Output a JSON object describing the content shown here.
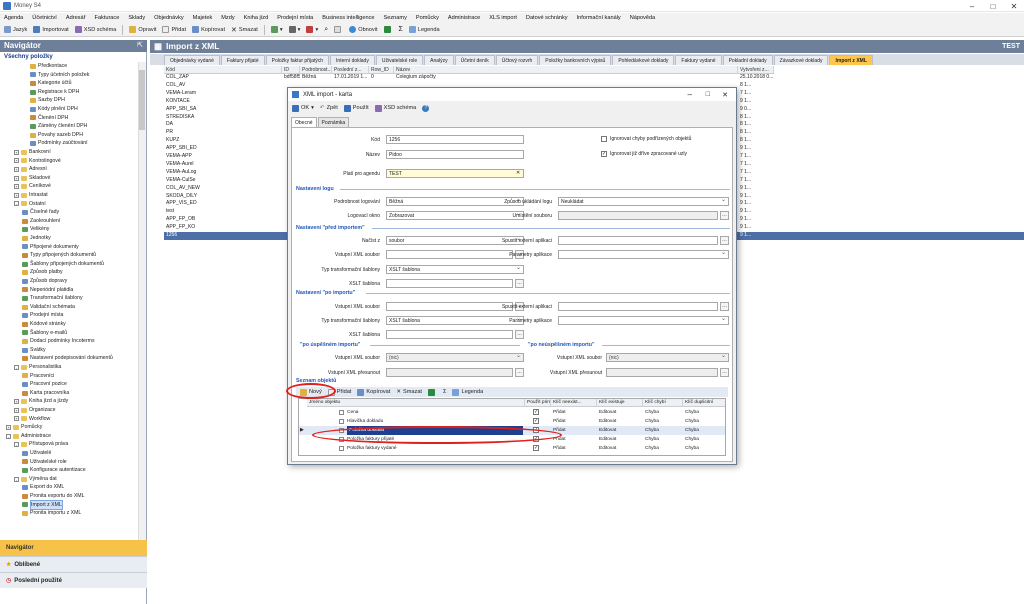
{
  "app": {
    "title": "Money S4"
  },
  "menu": [
    "Agenda",
    "Účetnictví",
    "Adresář",
    "Fakturace",
    "Sklady",
    "Objednávky",
    "Majetek",
    "Mzdy",
    "Kniha jízd",
    "Prodejní místa",
    "Business intelligence",
    "Seznamy",
    "Pomůcky",
    "Administrace",
    "XLS import",
    "Datové schránky",
    "Informační kanály",
    "Nápověda"
  ],
  "toolbar": {
    "jazyk": "Jazyk",
    "importovat": "Importovat",
    "xsd": "XSD schéma",
    "opravit": "Opravit",
    "pridat": "Přidat",
    "kopirovat": "Kopírovat",
    "smazat": "Smazat",
    "obnovit": "Obnovit",
    "legenda": "Legenda"
  },
  "navigator": {
    "title": "Navigátor",
    "subtitle": "Všechny položky",
    "items": [
      {
        "label": "Předkontace",
        "indent": 3
      },
      {
        "label": "Typy účetních položek",
        "indent": 3
      },
      {
        "label": "Kategorie účtů",
        "indent": 3
      },
      {
        "label": "Registrace k DPH",
        "indent": 3
      },
      {
        "label": "Sazby DPH",
        "indent": 3
      },
      {
        "label": "Kódy plnění DPH",
        "indent": 3
      },
      {
        "label": "Členění DPH",
        "indent": 3
      },
      {
        "label": "Záměny členění DPH",
        "indent": 3
      },
      {
        "label": "Povahy sazeb DPH",
        "indent": 3
      },
      {
        "label": "Podmínky zaúčtování",
        "indent": 3
      },
      {
        "label": "Bankovní",
        "indent": 1,
        "exp": "+"
      },
      {
        "label": "Kontrolingové",
        "indent": 1,
        "exp": "+"
      },
      {
        "label": "Adresní",
        "indent": 1,
        "exp": "+"
      },
      {
        "label": "Skladové",
        "indent": 1,
        "exp": "+"
      },
      {
        "label": "Ceníkové",
        "indent": 1,
        "exp": "+"
      },
      {
        "label": "Intrastat",
        "indent": 1,
        "exp": "+"
      },
      {
        "label": "Ostatní",
        "indent": 1,
        "exp": "-"
      },
      {
        "label": "Číselné řady",
        "indent": 2
      },
      {
        "label": "Zaokrouhlení",
        "indent": 2
      },
      {
        "label": "Velikény",
        "indent": 2
      },
      {
        "label": "Jednotky",
        "indent": 2
      },
      {
        "label": "Připojené dokumenty",
        "indent": 2
      },
      {
        "label": "Typy připojených dokumentů",
        "indent": 2
      },
      {
        "label": "Šablony připojených dokumentů",
        "indent": 2
      },
      {
        "label": "Způsob platby",
        "indent": 2
      },
      {
        "label": "Způsob dopravy",
        "indent": 2
      },
      {
        "label": "Neperiódní platidla",
        "indent": 2
      },
      {
        "label": "Transformační šablony",
        "indent": 2
      },
      {
        "label": "Validační schémata",
        "indent": 2
      },
      {
        "label": "Prodejní místa",
        "indent": 2
      },
      {
        "label": "Kódové stránky",
        "indent": 2
      },
      {
        "label": "Šablony e-mailů",
        "indent": 2
      },
      {
        "label": "Dodací podmínky Incoterms",
        "indent": 2
      },
      {
        "label": "Svátky",
        "indent": 2
      },
      {
        "label": "Nastavení podepisování dokumentů",
        "indent": 2
      },
      {
        "label": "Personalistika",
        "indent": 1,
        "exp": "-"
      },
      {
        "label": "Pracovníci",
        "indent": 2
      },
      {
        "label": "Pracovní pozice",
        "indent": 2
      },
      {
        "label": "Karta pracovníka",
        "indent": 2
      },
      {
        "label": "Kniha jízd a jízdy",
        "indent": 1,
        "exp": "+"
      },
      {
        "label": "Organizace",
        "indent": 1,
        "exp": "+"
      },
      {
        "label": "Workflow",
        "indent": 1,
        "exp": "+"
      },
      {
        "label": "Pomůcky",
        "indent": 0,
        "exp": "+"
      },
      {
        "label": "Administrace",
        "indent": 0,
        "exp": "-"
      },
      {
        "label": "Přístupová práva",
        "indent": 1,
        "exp": "-"
      },
      {
        "label": "Uživatelé",
        "indent": 2
      },
      {
        "label": "Uživatelské role",
        "indent": 2
      },
      {
        "label": "Konfigurace autentizace",
        "indent": 2
      },
      {
        "label": "Výměna dat",
        "indent": 1,
        "exp": "-"
      },
      {
        "label": "Export do XML",
        "indent": 2
      },
      {
        "label": "Pronita exportu do XML",
        "indent": 2
      },
      {
        "label": "Import z XML",
        "indent": 2,
        "sel": true
      },
      {
        "label": "Pronita importu z XML",
        "indent": 2
      }
    ],
    "sections": [
      "Navigátor",
      "Oblíbené",
      "Poslední použité"
    ]
  },
  "main": {
    "title": "Import z XML",
    "right_label": "TEST",
    "tabs": [
      "Objednávky vydané",
      "Faktury přijaté",
      "Položky faktur přijatých",
      "Interní doklady",
      "Uživatelské role",
      "Analýzy",
      "Účetní deník",
      "Účtový rozvrh",
      "Položky bankovních výpisů",
      "Pohledávkové doklady",
      "Faktury vydané",
      "Pokladní doklady",
      "Závazkové doklady",
      "Import z XML"
    ],
    "columns": [
      "Kód",
      "ID",
      "Podrobnost...",
      "Poslední z...",
      "Row_ID",
      "Název",
      "Vytvořeni z..."
    ],
    "rows": [
      {
        "kod": "COL_ZAP",
        "id": "bdf58f54275...",
        "pod": "Běžná",
        "pos": "17.01.2019 1...",
        "row": "0",
        "nazev": "Colegium zápočty",
        "vyt": "25.10.2018 0..."
      },
      {
        "kod": "COL_AV",
        "id": "",
        "pod": "",
        "pos": "",
        "row": "",
        "nazev": "",
        "vyt": "8 1..."
      },
      {
        "kod": "VEMA-Leram",
        "id": "",
        "pod": "",
        "pos": "",
        "row": "",
        "nazev": "",
        "vyt": "7 1..."
      },
      {
        "kod": "KONTACE",
        "id": "",
        "pod": "",
        "pos": "",
        "row": "",
        "nazev": "",
        "vyt": "9 1..."
      },
      {
        "kod": "APP_SBI_SA",
        "id": "",
        "pod": "",
        "pos": "",
        "row": "",
        "nazev": "",
        "vyt": "9 0..."
      },
      {
        "kod": "STREDISKA",
        "id": "",
        "pod": "",
        "pos": "",
        "row": "",
        "nazev": "",
        "vyt": "8 1..."
      },
      {
        "kod": "DA",
        "id": "",
        "pod": "",
        "pos": "",
        "row": "",
        "nazev": "",
        "vyt": "8 1..."
      },
      {
        "kod": "PR",
        "id": "",
        "pod": "",
        "pos": "",
        "row": "",
        "nazev": "",
        "vyt": "8 1..."
      },
      {
        "kod": "KUPZ",
        "id": "",
        "pod": "",
        "pos": "",
        "row": "",
        "nazev": "",
        "vyt": "8 1..."
      },
      {
        "kod": "APP_SBI_ED",
        "id": "",
        "pod": "",
        "pos": "",
        "row": "",
        "nazev": "",
        "vyt": "9 1..."
      },
      {
        "kod": "VEMA-APP",
        "id": "",
        "pod": "",
        "pos": "",
        "row": "",
        "nazev": "",
        "vyt": "7 1..."
      },
      {
        "kod": "VEMA-Aurel",
        "id": "",
        "pod": "",
        "pos": "",
        "row": "",
        "nazev": "",
        "vyt": "7 1..."
      },
      {
        "kod": "VEMA-AuLog",
        "id": "",
        "pod": "",
        "pos": "",
        "row": "",
        "nazev": "",
        "vyt": "7 1..."
      },
      {
        "kod": "VEMA-CulSe",
        "id": "",
        "pod": "",
        "pos": "",
        "row": "",
        "nazev": "",
        "vyt": "7 1..."
      },
      {
        "kod": "COL_AV_NEW",
        "id": "",
        "pod": "",
        "pos": "",
        "row": "",
        "nazev": "",
        "vyt": "9 1..."
      },
      {
        "kod": "SKODA_DILY",
        "id": "",
        "pod": "",
        "pos": "",
        "row": "",
        "nazev": "",
        "vyt": "9 1..."
      },
      {
        "kod": "APP_VIS_ED",
        "id": "",
        "pod": "",
        "pos": "",
        "row": "",
        "nazev": "",
        "vyt": "9 1..."
      },
      {
        "kod": "test",
        "id": "",
        "pod": "",
        "pos": "",
        "row": "",
        "nazev": "",
        "vyt": "9 1..."
      },
      {
        "kod": "APP_FP_OB",
        "id": "",
        "pod": "",
        "pos": "",
        "row": "",
        "nazev": "",
        "vyt": "9 1..."
      },
      {
        "kod": "APP_FP_KO",
        "id": "",
        "pod": "",
        "pos": "",
        "row": "",
        "nazev": "",
        "vyt": "9 1..."
      },
      {
        "kod": "1256",
        "id": "",
        "pod": "",
        "pos": "",
        "row": "",
        "nazev": "",
        "vyt": "9 1...",
        "sel": true
      }
    ]
  },
  "dialog": {
    "title": "XML import - karta",
    "toolbar": {
      "ok": "OK",
      "zpet": "Zpět",
      "pouzit": "Použít",
      "xsd": "XSD schéma"
    },
    "tabs": [
      "Obecné",
      "Poznámka"
    ],
    "kod_label": "Kód",
    "kod": "1256",
    "nazev_label": "Název",
    "nazev": "Pidoo",
    "agenda_label": "Platí pro agendu",
    "agenda": "TEST",
    "chk1": "Ignorovat chyby podřízených objektů",
    "chk2": "Ignorovat již dříve zpracované uzly",
    "sec_log": "Nastavení logu",
    "podrobnost_label": "Podrobnost logování",
    "podrobnost": "Běžná",
    "zpusob_label": "Způsob ukládání logu",
    "zpusob": "Neukládat",
    "logokno_label": "Logovací okno",
    "logokno": "Zobrazovat",
    "umisteni_label": "Umístění souboru",
    "sec_pred": "Nastavení \"před importem\"",
    "nacist_label": "Načíst z",
    "nacist": "soubor",
    "spustit_label": "Spustit externí aplikaci",
    "vstup_label": "Vstupní XML soubor",
    "param_label": "Parametry aplikace",
    "typ_label": "Typ transformační šablony",
    "typ": "XSLT šablona",
    "xslt_label": "XSLT šablona",
    "sec_po": "Nastavení \"po importu\"",
    "sec_uspesne": "\"po úspěšném importu\"",
    "sec_neuspesne": "\"po neúspěšném importu\"",
    "vstup_sel": "(nic)",
    "presun_label": "Vstupní XML přesunout",
    "sec_obj": "Seznam objektů",
    "obj_toolbar": {
      "novy": "Nový",
      "pridat": "Přidat",
      "kopirovat": "Kopírovat",
      "smazat": "Smazat",
      "legenda": "Legenda"
    },
    "obj_columns": [
      "Jméno objektu",
      "Použít prim...",
      "Klíč neexist...",
      "Klíč existuje",
      "Klíč chybí",
      "Klíč duplicitní"
    ],
    "obj_rows": [
      {
        "name": "Cena",
        "a": "Přidat",
        "b": "Editovat",
        "c": "Chyba",
        "d": "Chyba"
      },
      {
        "name": "Hlavička dokladu",
        "a": "Přidat",
        "b": "Editovat",
        "c": "Chyba",
        "d": "Chyba"
      },
      {
        "name": "Položka dokladu",
        "a": "Přidat",
        "b": "Editovat",
        "c": "Chyba",
        "d": "Chyba",
        "sel": true
      },
      {
        "name": "Položka faktury přijaté",
        "a": "Přidat",
        "b": "Editovat",
        "c": "Chyba",
        "d": "Chyba"
      },
      {
        "name": "Položka faktury vydané",
        "a": "Přidat",
        "b": "Editovat",
        "c": "Chyba",
        "d": "Chyba"
      }
    ]
  }
}
